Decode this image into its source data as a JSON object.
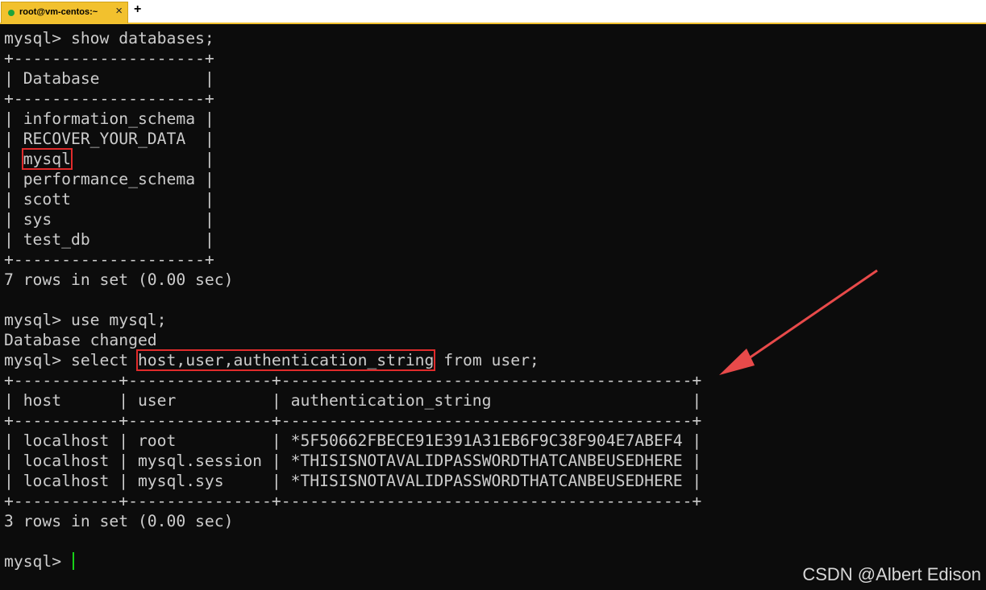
{
  "tab": {
    "title": "root@vm-centos:~",
    "close_label": "×",
    "new_tab_label": "+"
  },
  "terminal": {
    "lines": [
      "mysql> show databases;",
      "+--------------------+",
      "| Database           |",
      "+--------------------+",
      "| information_schema |",
      "| RECOVER_YOUR_DATA  |",
      "| mysql              |",
      "| performance_schema |",
      "| scott              |",
      "| sys                |",
      "| test_db            |",
      "+--------------------+",
      "7 rows in set (0.00 sec)",
      "",
      "mysql> use mysql;",
      "Database changed",
      "mysql> select host,user,authentication_string from user;",
      "+-----------+---------------+-------------------------------------------+",
      "| host      | user          | authentication_string                     |",
      "+-----------+---------------+-------------------------------------------+",
      "| localhost | root          | *5F50662FBECE91E391A31EB6F9C38F904E7ABEF4 |",
      "| localhost | mysql.session | *THISISNOTAVALIDPASSWORDTHATCANBEUSEDHERE |",
      "| localhost | mysql.sys     | *THISISNOTAVALIDPASSWORDTHATCANBEUSEDHERE |",
      "+-----------+---------------+-------------------------------------------+",
      "3 rows in set (0.00 sec)",
      "",
      "mysql> "
    ],
    "highlights": {
      "mysql_row": {
        "before": "| ",
        "text": "mysql",
        "after": "              |"
      },
      "select_query": {
        "before": "mysql> select ",
        "text": "host,user,authentication_string",
        "after": " from user;"
      }
    },
    "colors": {
      "background": "#0c0c0c",
      "text": "#cccccc",
      "highlight_box": "#e02b2b",
      "arrow": "#e84a4a",
      "cursor": "#18d018"
    }
  },
  "watermark": "CSDN @Albert Edison"
}
